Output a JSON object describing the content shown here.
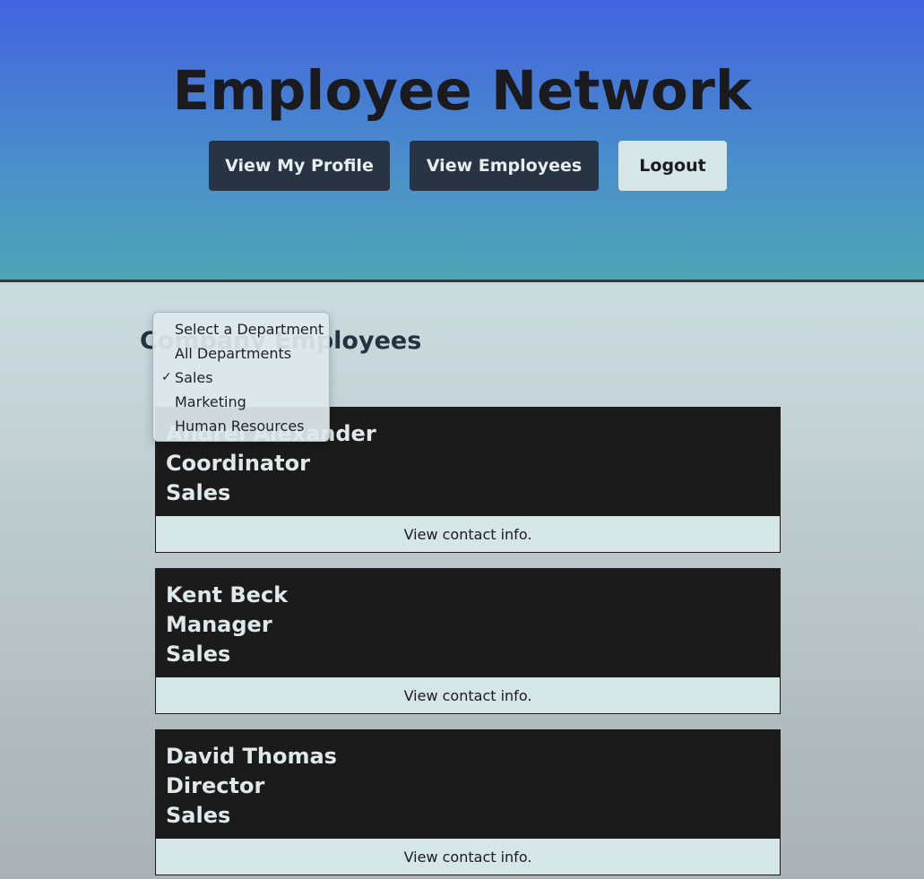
{
  "header": {
    "title": "Employee Network",
    "nav": [
      {
        "label": "View My Profile"
      },
      {
        "label": "View Employees"
      },
      {
        "label": "Logout"
      }
    ]
  },
  "section": {
    "title": "Company Employees"
  },
  "department_select": {
    "selected": "Sales",
    "options": [
      {
        "label": "Select a Department"
      },
      {
        "label": "All Departments"
      },
      {
        "label": "Sales",
        "checked": true
      },
      {
        "label": "Marketing"
      },
      {
        "label": "Human Resources"
      }
    ],
    "check_icon": "checkmark-icon"
  },
  "employees": [
    {
      "name": "Andrei Alexander",
      "title": "Coordinator",
      "department": "Sales",
      "action": "View contact info."
    },
    {
      "name": "Kent Beck",
      "title": "Manager",
      "department": "Sales",
      "action": "View contact info."
    },
    {
      "name": "David Thomas",
      "title": "Director",
      "department": "Sales",
      "action": "View contact info."
    }
  ],
  "colors": {
    "header_gradient_top": "#4363e0",
    "header_gradient_bottom": "#4fa5b5",
    "dark_button": "#283444",
    "light_button": "#d5e6e7",
    "card_bg": "#1b1b1b"
  }
}
